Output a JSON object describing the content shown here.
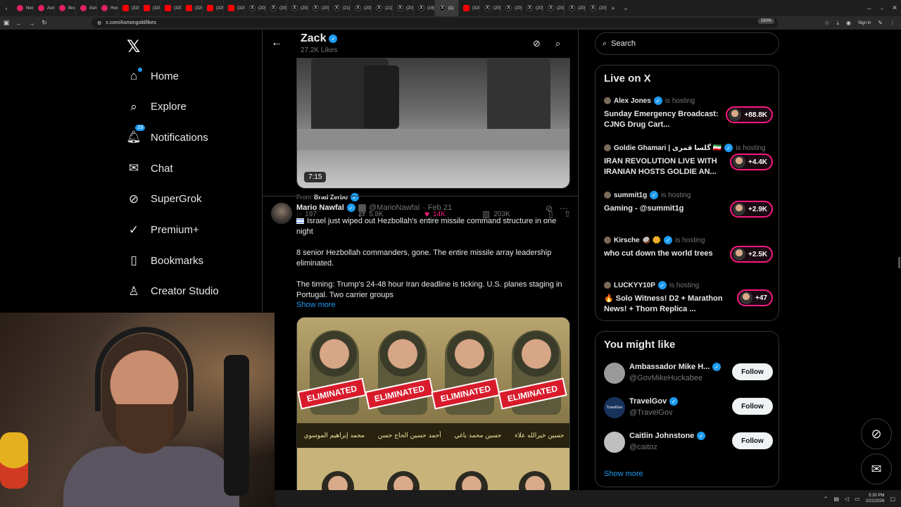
{
  "browser": {
    "tabs": [
      {
        "label": "New",
        "icon": "red"
      },
      {
        "label": "Asmo",
        "icon": "red"
      },
      {
        "label": "Bro g",
        "icon": "red"
      },
      {
        "label": "Asmo",
        "icon": "red"
      },
      {
        "label": "How",
        "icon": "red"
      },
      {
        "label": "(3207",
        "icon": "yt"
      },
      {
        "label": "(3207",
        "icon": "yt"
      },
      {
        "label": "(3207",
        "icon": "yt"
      },
      {
        "label": "(3207",
        "icon": "yt"
      },
      {
        "label": "(3207",
        "icon": "yt"
      },
      {
        "label": "(3208",
        "icon": "yt"
      },
      {
        "label": "(20) I",
        "icon": "x"
      },
      {
        "label": "(20) I",
        "icon": "x"
      },
      {
        "label": "(20) \"",
        "icon": "x"
      },
      {
        "label": "(20) I",
        "icon": "x"
      },
      {
        "label": "(21) I",
        "icon": "x"
      },
      {
        "label": "(20) G",
        "icon": "x"
      },
      {
        "label": "(21) I",
        "icon": "x"
      },
      {
        "label": "(20) I",
        "icon": "x"
      },
      {
        "label": "(16) I",
        "icon": "x"
      },
      {
        "label": "(1)",
        "icon": "x",
        "active": true
      },
      {
        "label": "(3207",
        "icon": "yt"
      },
      {
        "label": "(20) C",
        "icon": "x"
      },
      {
        "label": "(20) S",
        "icon": "x"
      },
      {
        "label": "(20) y",
        "icon": "x"
      },
      {
        "label": "(20) I",
        "icon": "x"
      },
      {
        "label": "(20) I",
        "icon": "x"
      },
      {
        "label": "(20) I",
        "icon": "x"
      }
    ],
    "url": "x.com/Asmongold/likes",
    "zoom": "150%",
    "signin": "Sign in"
  },
  "nav": {
    "logo": "𝕏",
    "items": [
      {
        "label": "Home",
        "icon": "home-icon",
        "glyph": "⌂"
      },
      {
        "label": "Explore",
        "icon": "search-icon",
        "glyph": "⌕"
      },
      {
        "label": "Notifications",
        "icon": "bell-icon",
        "glyph": "🔔︎",
        "badge": "19"
      },
      {
        "label": "Chat",
        "icon": "mail-icon",
        "glyph": "✉"
      },
      {
        "label": "SuperGrok",
        "icon": "grok-icon",
        "glyph": "⊘"
      },
      {
        "label": "Premium+",
        "icon": "premium-icon",
        "glyph": "✓"
      },
      {
        "label": "Bookmarks",
        "icon": "bookmark-icon",
        "glyph": "▯"
      },
      {
        "label": "Creator Studio",
        "icon": "creator-icon",
        "glyph": "♙"
      }
    ]
  },
  "profile": {
    "name": "Zack",
    "sub": "27.2K Likes",
    "back": "←",
    "grok": "⊘",
    "search": "⌕"
  },
  "video_tweet": {
    "duration": "7:15",
    "from_prefix": "From",
    "from_name": "Brad Zerbo",
    "replies": "197",
    "reposts": "5.8K",
    "likes": "14K",
    "views": "203K"
  },
  "tweet": {
    "name": "Mario Nawfal",
    "handle": "@MarioNawfal",
    "date": "Feb 21",
    "p1": "Israel just wiped out Hezbollah's entire missile command structure in one night",
    "p2": "8 senior Hezbollah commanders, gone. The entire missile array leadership eliminated.",
    "p3": "The timing: Trump's 24-48 hour Iran deadline is ticking. U.S. planes staging in Portugal. Two carrier groups",
    "show_more": "Show more",
    "image_labels": [
      "ELIMINATED",
      "ELIMINATED",
      "ELIMINATED",
      "ELIMINATED"
    ],
    "image_names": [
      "محمد إبراهيم الموسوي",
      "أحمد حسين الحاج حسن",
      "حسين محمد باغي",
      "حسين خيرالله علاء"
    ]
  },
  "right": {
    "search_placeholder": "Search",
    "live_title": "Live on X",
    "live": [
      {
        "host": "Alex Jones",
        "title": "Sunday Emergency Broadcast: CJNG Drug Cart...",
        "count": "+88.8K"
      },
      {
        "host": "Goldie Ghamari | گلسا قمری 🇮🇷",
        "title": "IRAN REVOLUTION LIVE WITH IRANIAN HOSTS GOLDIE AN...",
        "count": "+4.4K"
      },
      {
        "host": "summit1g",
        "title": "Gaming - @summit1g",
        "count": "+2.9K"
      },
      {
        "host": "Kirsche 🥥 🌼",
        "title": "who cut down the world trees",
        "count": "+2.5K"
      },
      {
        "host": "LUCKYY10P",
        "title": "🔥 Solo Witness! D2 + Marathon News! + Thorn Replica ...",
        "count": "+47"
      }
    ],
    "hosting_label": "is hosting",
    "suggest_title": "You might like",
    "suggestions": [
      {
        "name": "Ambassador Mike H...",
        "handle": "@GovMikeHuckabee",
        "avatar_color": "#9a9a9a"
      },
      {
        "name": "TravelGov",
        "handle": "@TravelGov",
        "avatar_color": "#17335c",
        "avatar_text": "TravelGov"
      },
      {
        "name": "Caitlin Johnstone",
        "handle": "@caitoz",
        "avatar_color": "#bfbfbf"
      }
    ],
    "follow_label": "Follow",
    "show_more": "Show more"
  },
  "taskbar": {
    "time": "5:30 PM",
    "date": "2/22/2026"
  }
}
